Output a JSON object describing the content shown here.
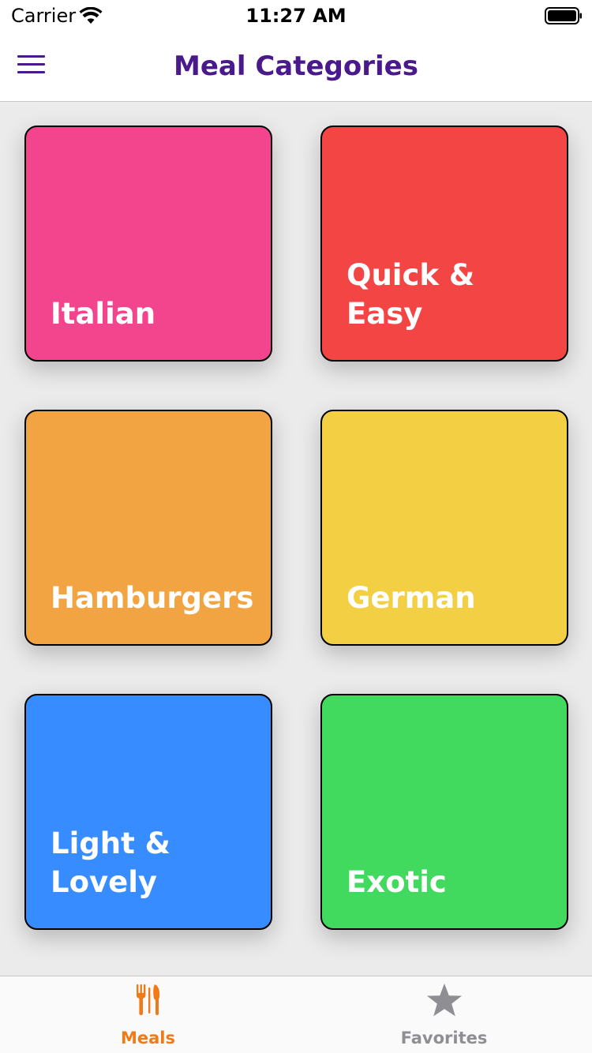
{
  "status_bar": {
    "carrier": "Carrier",
    "time": "11:27 AM"
  },
  "nav": {
    "title": "Meal Categories",
    "menu_icon": "hamburger-menu-icon",
    "title_color": "#4a1a8c"
  },
  "categories": [
    {
      "label": "Italian",
      "color": "#f2458d"
    },
    {
      "label": "Quick & Easy",
      "color": "#f44545"
    },
    {
      "label": "Hamburgers",
      "color": "#f2a442"
    },
    {
      "label": "German",
      "color": "#f3cf44"
    },
    {
      "label": "Light & Lovely",
      "color": "#378cff"
    },
    {
      "label": "Exotic",
      "color": "#42d95f"
    }
  ],
  "tabs": [
    {
      "label": "Meals",
      "icon": "fork-knife-icon",
      "active": true,
      "color": "#f07a18"
    },
    {
      "label": "Favorites",
      "icon": "star-icon",
      "active": false,
      "color": "#8e8e93"
    }
  ]
}
